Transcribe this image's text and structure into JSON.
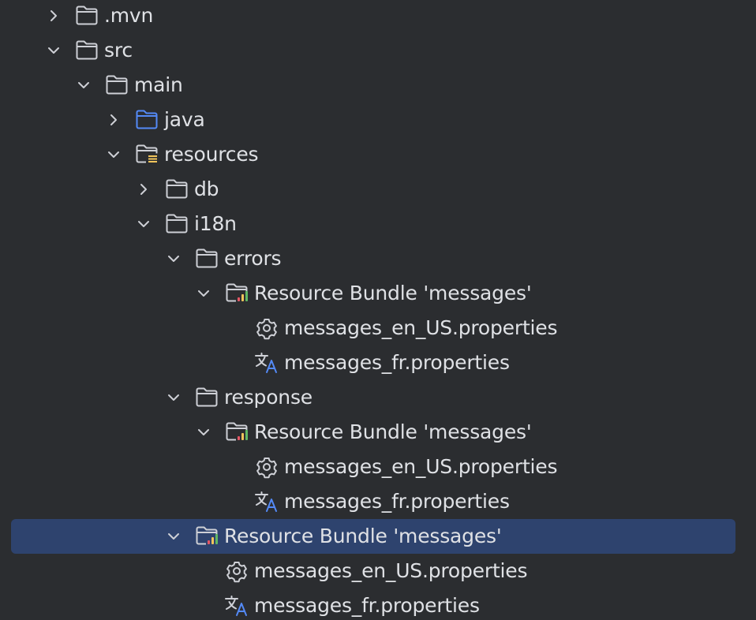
{
  "tree": {
    "nodes": [
      {
        "label": ".mvn",
        "chevron": "right",
        "icon": "folder-icon"
      },
      {
        "label": "src",
        "chevron": "down",
        "icon": "folder-icon"
      },
      {
        "label": "main",
        "chevron": "down",
        "icon": "folder-icon"
      },
      {
        "label": "java",
        "chevron": "right",
        "icon": "source-folder-icon"
      },
      {
        "label": "resources",
        "chevron": "down",
        "icon": "resources-folder-icon"
      },
      {
        "label": "db",
        "chevron": "right",
        "icon": "folder-icon"
      },
      {
        "label": "i18n",
        "chevron": "down",
        "icon": "folder-icon"
      },
      {
        "label": "errors",
        "chevron": "down",
        "icon": "folder-icon"
      },
      {
        "label": "Resource Bundle 'messages'",
        "chevron": "down",
        "icon": "resource-bundle-icon"
      },
      {
        "label": "messages_en_US.properties",
        "chevron": "none",
        "icon": "gear-icon"
      },
      {
        "label": "messages_fr.properties",
        "chevron": "none",
        "icon": "translate-icon"
      },
      {
        "label": "response",
        "chevron": "down",
        "icon": "folder-icon"
      },
      {
        "label": "Resource Bundle 'messages'",
        "chevron": "down",
        "icon": "resource-bundle-icon"
      },
      {
        "label": "messages_en_US.properties",
        "chevron": "none",
        "icon": "gear-icon"
      },
      {
        "label": "messages_fr.properties",
        "chevron": "none",
        "icon": "translate-icon"
      },
      {
        "label": "Resource Bundle 'messages'",
        "chevron": "down",
        "icon": "resource-bundle-icon",
        "selected": true
      },
      {
        "label": "messages_en_US.properties",
        "chevron": "none",
        "icon": "gear-icon"
      },
      {
        "label": "messages_fr.properties",
        "chevron": "none",
        "icon": "translate-icon"
      }
    ]
  },
  "colors": {
    "background": "#2b2d30",
    "selection": "#2e436e",
    "text": "#dfe1e5",
    "chevron": "#ced0d6",
    "folder_stroke": "#ced0d6",
    "source_folder_stroke": "#548af7",
    "bundle_bar_red": "#e55765",
    "bundle_bar_yellow": "#f2c55c",
    "bundle_bar_green": "#5fb865",
    "translate_blue": "#548af7"
  }
}
